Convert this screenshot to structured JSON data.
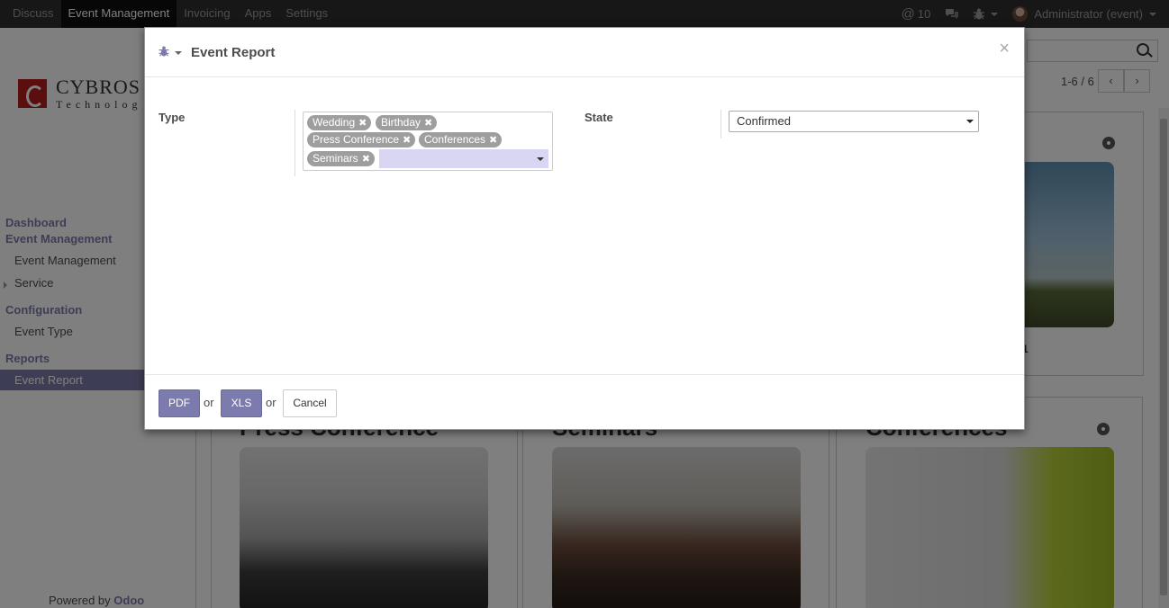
{
  "navbar": {
    "menus": [
      "Discuss",
      "Event Management",
      "Invoicing",
      "Apps",
      "Settings"
    ],
    "active_menu": "Event Management",
    "mentions_count": "10",
    "user": "Administrator (event)"
  },
  "sidebar": {
    "logo_name": "CYBROS",
    "logo_sub": "Technolog",
    "sections": [
      {
        "head": "Dashboard"
      },
      {
        "head": "Event Management",
        "items": [
          "Event Management",
          "Service"
        ]
      },
      {
        "head": "Configuration",
        "items": [
          "Event Type"
        ]
      },
      {
        "head": "Reports",
        "items": [
          "Event Report"
        ]
      }
    ],
    "active_item": "Event Report",
    "powered_by": "Powered by",
    "powered_brand": "Odoo"
  },
  "background": {
    "pager": "1-6 / 6",
    "cards": [
      {
        "title": "Press Conference"
      },
      {
        "title": "Seminars"
      },
      {
        "title": "Conferences"
      }
    ],
    "card_fragment": "1"
  },
  "modal": {
    "title": "Event Report",
    "type_label": "Type",
    "type_tags": [
      "Wedding",
      "Birthday",
      "Press Conference",
      "Conferences",
      "Seminars"
    ],
    "state_label": "State",
    "state_value": "Confirmed",
    "footer": {
      "pdf_label": "PDF",
      "or_text": "or",
      "xls_label": "XLS",
      "cancel_label": "Cancel"
    }
  },
  "colors": {
    "accent": "#7c7bad",
    "navbar": "#2f2f2f",
    "tag": "#9e9e9e"
  }
}
